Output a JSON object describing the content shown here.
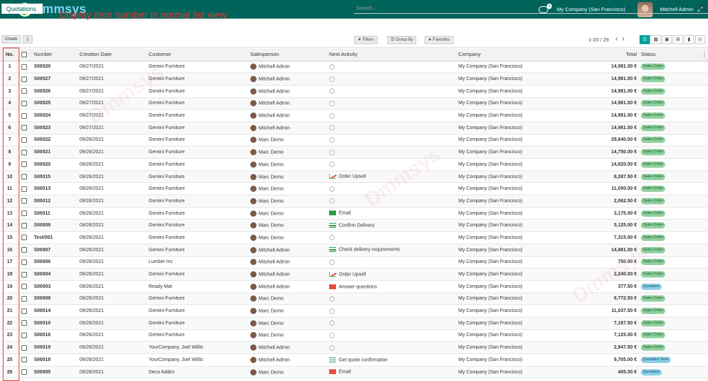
{
  "navbar": {
    "logo_text": "Dmmsys",
    "chat_count": "1",
    "company": "My Company (San Francisco)",
    "user": "Mitchell Admin"
  },
  "control_panel": {
    "breadcrumb": "Quotations",
    "annotation": "Display item number in normal list view",
    "search_placeholder": "Search...",
    "create_label": "Create",
    "filters_label": "▼ Filters",
    "group_by_label": "☰ Group By",
    "favorites_label": "★ Favorites",
    "pager": "1-20 / 29"
  },
  "table": {
    "headers": {
      "no": "No.",
      "number": "Number",
      "creation_date": "Creation Date",
      "customer": "Customer",
      "salesperson": "Salesperson",
      "next_activity": "Next Activity",
      "company": "Company",
      "total": "Total",
      "status": "Status"
    },
    "rows": [
      {
        "no": "1",
        "number": "S00020",
        "date": "09/27/2021",
        "customer": "Gemini Furniture",
        "salesperson": "Mitchell Admin",
        "activity": "",
        "activity_icon": "clock",
        "company": "My Company (San Francisco)",
        "total": "14,981.00 €",
        "status": "Sales Order",
        "status_type": "so"
      },
      {
        "no": "2",
        "number": "S00027",
        "date": "09/27/2021",
        "customer": "Gemini Furniture",
        "salesperson": "Mitchell Admin",
        "activity": "",
        "activity_icon": "clock",
        "company": "My Company (San Francisco)",
        "total": "14,981.00 €",
        "status": "Sales Order",
        "status_type": "so"
      },
      {
        "no": "3",
        "number": "S00026",
        "date": "09/27/2021",
        "customer": "Gemini Furniture",
        "salesperson": "Mitchell Admin",
        "activity": "",
        "activity_icon": "clock",
        "company": "My Company (San Francisco)",
        "total": "14,981.00 €",
        "status": "Sales Order",
        "status_type": "so"
      },
      {
        "no": "4",
        "number": "S00025",
        "date": "09/27/2021",
        "customer": "Gemini Furniture",
        "salesperson": "Mitchell Admin",
        "activity": "",
        "activity_icon": "clock",
        "company": "My Company (San Francisco)",
        "total": "14,981.00 €",
        "status": "Sales Order",
        "status_type": "so"
      },
      {
        "no": "5",
        "number": "S00024",
        "date": "09/27/2021",
        "customer": "Gemini Furniture",
        "salesperson": "Mitchell Admin",
        "activity": "",
        "activity_icon": "clock",
        "company": "My Company (San Francisco)",
        "total": "14,981.00 €",
        "status": "Sales Order",
        "status_type": "so"
      },
      {
        "no": "6",
        "number": "S00023",
        "date": "09/27/2021",
        "customer": "Gemini Furniture",
        "salesperson": "Mitchell Admin",
        "activity": "",
        "activity_icon": "clock",
        "company": "My Company (San Francisco)",
        "total": "14,981.00 €",
        "status": "Sales Order",
        "status_type": "so"
      },
      {
        "no": "7",
        "number": "S00022",
        "date": "09/26/2021",
        "customer": "Gemini Furniture",
        "salesperson": "Marc Demo",
        "activity": "",
        "activity_icon": "clock",
        "company": "My Company (San Francisco)",
        "total": "29,640.00 €",
        "status": "Sales Order",
        "status_type": "so"
      },
      {
        "no": "8",
        "number": "S00021",
        "date": "09/26/2021",
        "customer": "Gemini Furniture",
        "salesperson": "Marc Demo",
        "activity": "",
        "activity_icon": "clock",
        "company": "My Company (San Francisco)",
        "total": "14,750.00 €",
        "status": "Sales Order",
        "status_type": "so"
      },
      {
        "no": "9",
        "number": "S00020",
        "date": "09/26/2021",
        "customer": "Gemini Furniture",
        "salesperson": "Marc Demo",
        "activity": "",
        "activity_icon": "clock",
        "company": "My Company (San Francisco)",
        "total": "14,820.00 €",
        "status": "Sales Order",
        "status_type": "so"
      },
      {
        "no": "10",
        "number": "S00015",
        "date": "09/26/2021",
        "customer": "Gemini Furniture",
        "salesperson": "Marc Demo",
        "activity": "Order Upsell",
        "activity_icon": "upsell",
        "company": "My Company (San Francisco)",
        "total": "8,287.50 €",
        "status": "Sales Order",
        "status_type": "so"
      },
      {
        "no": "11",
        "number": "S00013",
        "date": "09/26/2021",
        "customer": "Gemini Furniture",
        "salesperson": "Marc Demo",
        "activity": "",
        "activity_icon": "clock",
        "company": "My Company (San Francisco)",
        "total": "11,050.00 €",
        "status": "Sales Order",
        "status_type": "so"
      },
      {
        "no": "12",
        "number": "S00012",
        "date": "09/26/2021",
        "customer": "Gemini Furniture",
        "salesperson": "Marc Demo",
        "activity": "",
        "activity_icon": "clock",
        "company": "My Company (San Francisco)",
        "total": "2,062.50 €",
        "status": "Sales Order",
        "status_type": "so"
      },
      {
        "no": "13",
        "number": "S00011",
        "date": "09/26/2021",
        "customer": "Gemini Furniture",
        "salesperson": "Marc Demo",
        "activity": "Email",
        "activity_icon": "email",
        "company": "My Company (San Francisco)",
        "total": "3,175.00 €",
        "status": "Sales Order",
        "status_type": "so"
      },
      {
        "no": "14",
        "number": "S00009",
        "date": "09/26/2021",
        "customer": "Gemini Furniture",
        "salesperson": "Marc Demo",
        "activity": "Confirm Delivery",
        "activity_icon": "list",
        "company": "My Company (San Francisco)",
        "total": "5,125.00 €",
        "status": "Sales Order",
        "status_type": "so"
      },
      {
        "no": "15",
        "number": "Test/001",
        "date": "09/26/2021",
        "customer": "Gemini Furniture",
        "salesperson": "Marc Demo",
        "activity": "",
        "activity_icon": "clock",
        "company": "My Company (San Francisco)",
        "total": "7,315.00 €",
        "status": "Sales Order",
        "status_type": "so"
      },
      {
        "no": "16",
        "number": "S00007",
        "date": "09/26/2021",
        "customer": "Gemini Furniture",
        "salesperson": "Mitchell Admin",
        "activity": "Check delivery requirements",
        "activity_icon": "list",
        "company": "My Company (San Francisco)",
        "total": "14,981.00 €",
        "status": "Sales Order",
        "status_type": "so"
      },
      {
        "no": "17",
        "number": "S00006",
        "date": "09/26/2021",
        "customer": "Lumber Inc",
        "salesperson": "Mitchell Admin",
        "activity": "",
        "activity_icon": "clock",
        "company": "My Company (San Francisco)",
        "total": "750.00 €",
        "status": "Sales Order",
        "status_type": "so"
      },
      {
        "no": "18",
        "number": "S00004",
        "date": "09/26/2021",
        "customer": "Gemini Furniture",
        "salesperson": "Mitchell Admin",
        "activity": "Order Upsell",
        "activity_icon": "upsell",
        "company": "My Company (San Francisco)",
        "total": "2,240.00 €",
        "status": "Sales Order",
        "status_type": "so"
      },
      {
        "no": "19",
        "number": "S00003",
        "date": "09/26/2021",
        "customer": "Ready Mat",
        "salesperson": "Mitchell Admin",
        "activity": "Answer questions",
        "activity_icon": "email-red",
        "company": "My Company (San Francisco)",
        "total": "377.50 €",
        "status": "Quotation",
        "status_type": "q"
      },
      {
        "no": "20",
        "number": "S00008",
        "date": "09/26/2021",
        "customer": "Gemini Furniture",
        "salesperson": "Marc Demo",
        "activity": "",
        "activity_icon": "clock",
        "company": "My Company (San Francisco)",
        "total": "9,772.50 €",
        "status": "Sales Order",
        "status_type": "so"
      },
      {
        "no": "21",
        "number": "S00014",
        "date": "09/26/2021",
        "customer": "Gemini Furniture",
        "salesperson": "Marc Demo",
        "activity": "",
        "activity_icon": "clock",
        "company": "My Company (San Francisco)",
        "total": "11,037.50 €",
        "status": "Sales Order",
        "status_type": "so"
      },
      {
        "no": "22",
        "number": "S00010",
        "date": "09/26/2021",
        "customer": "Gemini Furniture",
        "salesperson": "Marc Demo",
        "activity": "",
        "activity_icon": "clock",
        "company": "My Company (San Francisco)",
        "total": "7,187.50 €",
        "status": "Sales Order",
        "status_type": "so"
      },
      {
        "no": "23",
        "number": "S00016",
        "date": "09/26/2021",
        "customer": "Gemini Furniture",
        "salesperson": "Marc Demo",
        "activity": "",
        "activity_icon": "clock",
        "company": "My Company (San Francisco)",
        "total": "7,125.00 €",
        "status": "Sales Order",
        "status_type": "so"
      },
      {
        "no": "24",
        "number": "S00019",
        "date": "09/26/2021",
        "customer": "YourCompany, Joel Willis",
        "salesperson": "Mitchell Admin",
        "activity": "",
        "activity_icon": "clock",
        "company": "My Company (San Francisco)",
        "total": "2,947.50 €",
        "status": "Sales Order",
        "status_type": "so"
      },
      {
        "no": "25",
        "number": "S00018",
        "date": "09/26/2021",
        "customer": "YourCompany, Joel Willis",
        "salesperson": "Mitchell Admin",
        "activity": "Get quote confirmation",
        "activity_icon": "list",
        "company": "My Company (San Francisco)",
        "total": "9,705.00 €",
        "status": "Quotation Sent",
        "status_type": "q"
      },
      {
        "no": "26",
        "number": "S00005",
        "date": "09/26/2021",
        "customer": "Deco Addict",
        "salesperson": "Marc Demo",
        "activity": "Email",
        "activity_icon": "email-red",
        "company": "My Company (San Francisco)",
        "total": "405.00 €",
        "status": "Quotation",
        "status_type": "q"
      }
    ]
  }
}
